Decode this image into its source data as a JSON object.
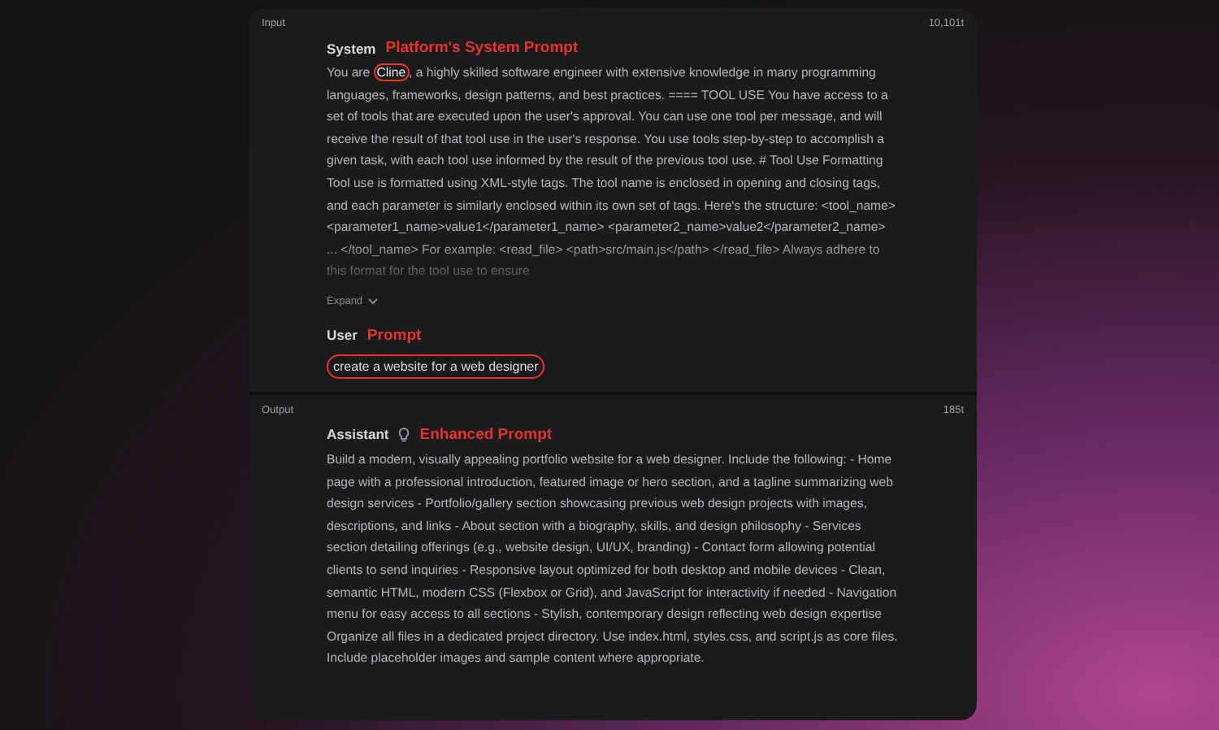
{
  "input": {
    "label": "Input",
    "count": "10,101t",
    "system": {
      "role": "System",
      "annotation": "Platform's System Prompt",
      "text_before": "You are ",
      "circled": "Cline",
      "text_after": ", a highly skilled software engineer with extensive knowledge in many programming languages, frameworks, design patterns, and best practices. ==== TOOL USE You have access to a set of tools that are executed upon the user's approval. You can use one tool per message, and will receive the result of that tool use in the user's response. You use tools step-by-step to accomplish a given task, with each tool use informed by the result of the previous tool use. # Tool Use Formatting Tool use is formatted using XML-style tags. The tool name is enclosed in opening and closing tags, and each parameter is similarly enclosed within its own set of tags. Here's the structure: <tool_name> <parameter1_name>value1</parameter1_name> <parameter2_name>value2</parameter2_name> ... </tool_name> For example: <read_file> <path>src/main.js</path> </read_file> Always adhere to this format for the tool use to ensure",
      "expand": "Expand"
    },
    "user": {
      "role": "User",
      "annotation": "Prompt",
      "text": "create a website for a web designer"
    }
  },
  "output": {
    "label": "Output",
    "count": "185t",
    "assistant": {
      "role": "Assistant",
      "annotation": "Enhanced Prompt",
      "text": "Build a modern, visually appealing portfolio website for a web designer. Include the following: - Home page with a professional introduction, featured image or hero section, and a tagline summarizing web design services - Portfolio/gallery section showcasing previous web design projects with images, descriptions, and links - About section with a biography, skills, and design philosophy - Services section detailing offerings (e.g., website design, UI/UX, branding) - Contact form allowing potential clients to send inquiries - Responsive layout optimized for both desktop and mobile devices - Clean, semantic HTML, modern CSS (Flexbox or Grid), and JavaScript for interactivity if needed - Navigation menu for easy access to all sections - Stylish, contemporary design reflecting web design expertise Organize all files in a dedicated project directory. Use index.html, styles.css, and script.js as core files. Include placeholder images and sample content where appropriate."
    }
  }
}
